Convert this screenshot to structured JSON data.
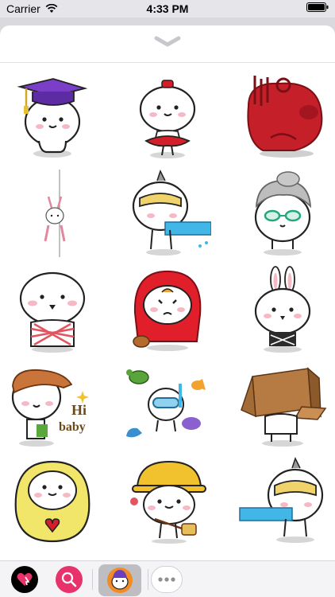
{
  "status_bar": {
    "carrier": "Carrier",
    "time": "4:33 PM"
  },
  "sheet": {
    "handle_icon": "chevron-down-icon"
  },
  "stickers": [
    {
      "name": "sticker-graduate",
      "caption": ""
    },
    {
      "name": "sticker-ballerina",
      "caption": ""
    },
    {
      "name": "sticker-red-piggy",
      "caption": ""
    },
    {
      "name": "sticker-bunny-ornament",
      "caption": ""
    },
    {
      "name": "sticker-visor-hose",
      "caption": ""
    },
    {
      "name": "sticker-grandma",
      "caption": ""
    },
    {
      "name": "sticker-tied-ribbon",
      "caption": ""
    },
    {
      "name": "sticker-red-hood",
      "caption": ""
    },
    {
      "name": "sticker-bunny-ears",
      "caption": ""
    },
    {
      "name": "sticker-hi-baby",
      "caption": "Hi\nbaby"
    },
    {
      "name": "sticker-snorkel",
      "caption": ""
    },
    {
      "name": "sticker-cardboard-box",
      "caption": ""
    },
    {
      "name": "sticker-yellow-hood",
      "caption": ""
    },
    {
      "name": "sticker-hardhat",
      "caption": ""
    },
    {
      "name": "sticker-visor-hose-2",
      "caption": ""
    }
  ],
  "tray": {
    "apps": [
      "digital-touch-icon",
      "search-images-icon",
      "sticker-pack-icon",
      "more-apps-icon"
    ]
  },
  "colors": {
    "tray_digital_touch": "#111111",
    "tray_search": "#e8326c",
    "sticker_red": "#d21f2a",
    "sticker_yellow": "#f1e66a"
  }
}
